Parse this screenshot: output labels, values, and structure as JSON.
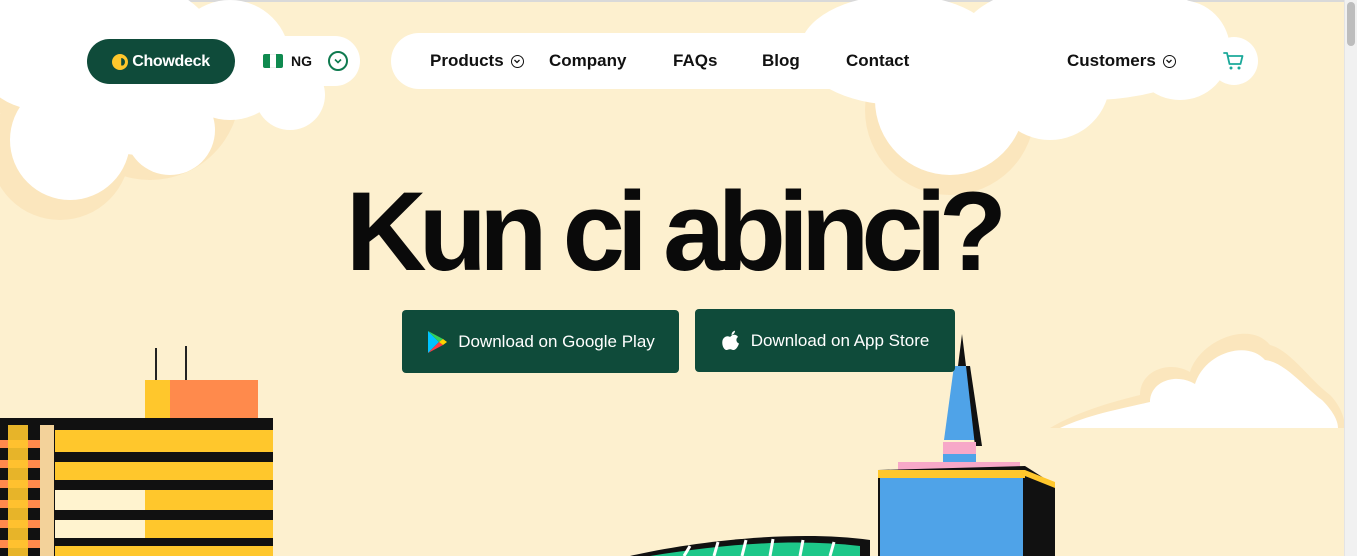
{
  "brand": {
    "name": "Chowdeck"
  },
  "country": {
    "code": "NG"
  },
  "nav": {
    "products": "Products",
    "company": "Company",
    "faqs": "FAQs",
    "blog": "Blog",
    "contact": "Contact",
    "customers": "Customers"
  },
  "hero": {
    "headline": "Kun ci abinci?",
    "google_play": "Download on Google Play",
    "app_store": "Download on App Store"
  },
  "icons": {
    "products_dropdown": "chevron-down-icon",
    "customers_dropdown": "chevron-down-icon",
    "country_dropdown": "chevron-down-circle-icon",
    "cart": "cart-icon",
    "google_play": "google-play-icon",
    "app_store": "apple-icon"
  },
  "colors": {
    "background": "#fdf0cf",
    "brand_green": "#0f4b3a",
    "accent_yellow": "#ffc72c",
    "cart_teal": "#1ba99a"
  }
}
